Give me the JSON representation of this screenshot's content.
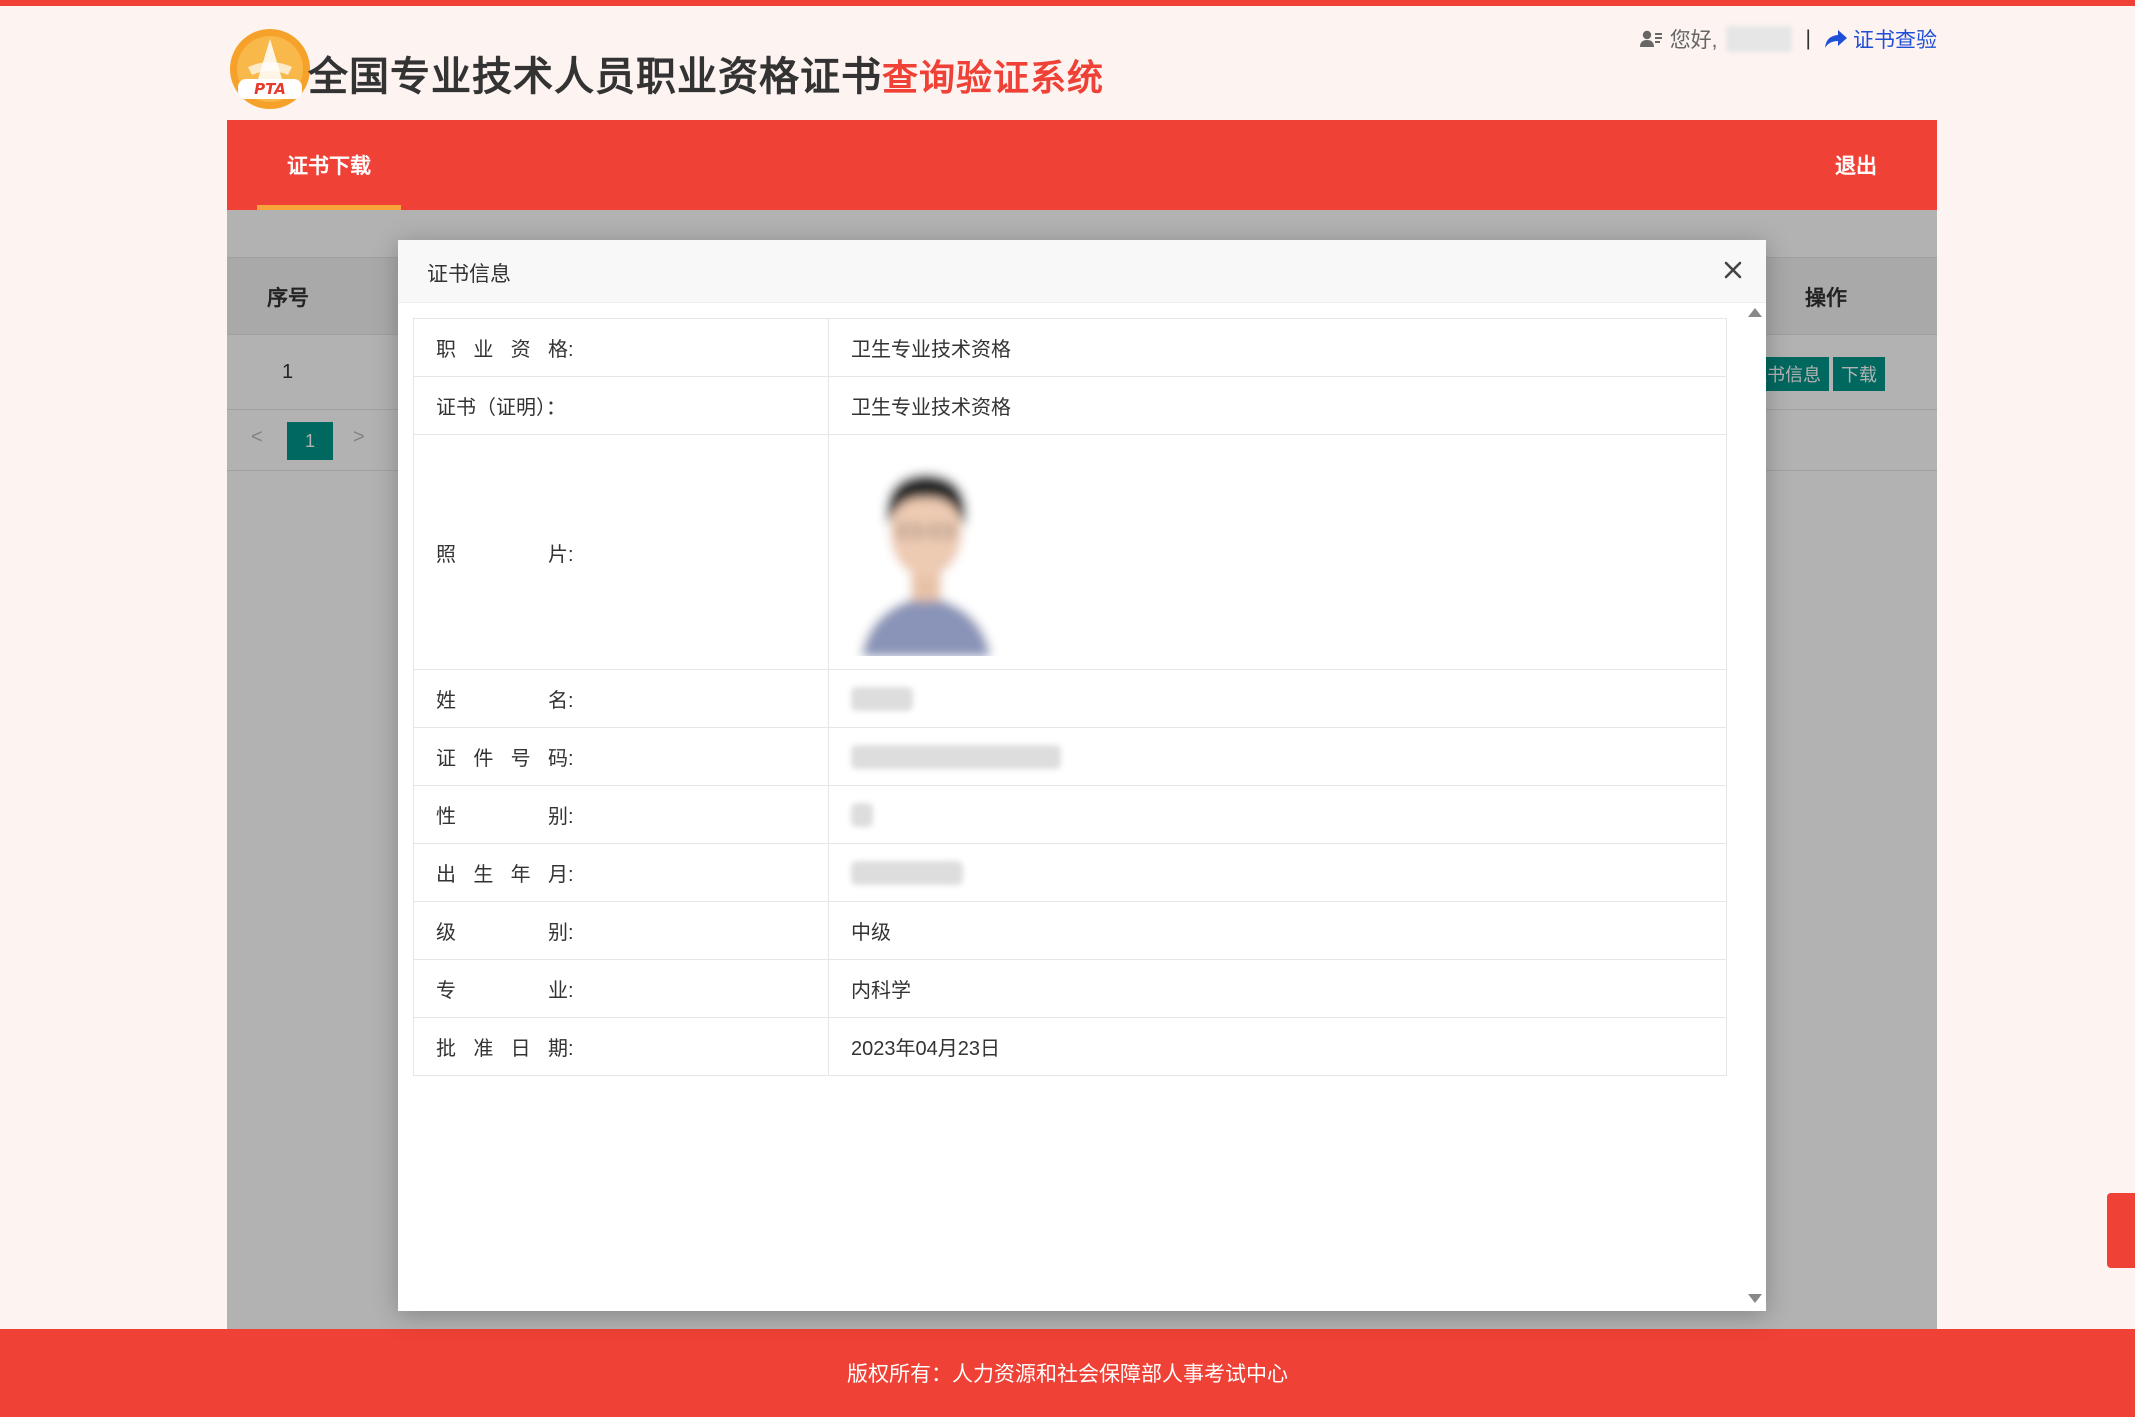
{
  "header": {
    "logo_text": "PTA",
    "title_main": "全国专业技术人员职业资格证书",
    "title_accent": "查询验证系统",
    "greeting": "您好,",
    "separator": "|",
    "verify_label": "证书查验"
  },
  "nav": {
    "active_tab": "证书下载",
    "logout": "退出"
  },
  "background_table": {
    "headers": {
      "index": "序号",
      "action": "操作"
    },
    "row": {
      "index": "1",
      "info_button": "证书信息",
      "download_button": "下载"
    },
    "pager": {
      "prev": "<",
      "current_page": "1",
      "next": ">"
    }
  },
  "modal": {
    "title": "证书信息",
    "rows": [
      {
        "label": "职业资格",
        "value": "卫生专业技术资格"
      },
      {
        "label": "证书（证明）",
        "value": "卫生专业技术资格"
      },
      {
        "label": "照片",
        "value": ""
      },
      {
        "label": "姓名",
        "value": ""
      },
      {
        "label": "证件号码",
        "value": ""
      },
      {
        "label": "性别",
        "value": ""
      },
      {
        "label": "出生年月",
        "value": ""
      },
      {
        "label": "级别",
        "value": "中级"
      },
      {
        "label": "专业",
        "value": "内科学"
      },
      {
        "label": "批准日期",
        "value": "2023年04月23日"
      }
    ],
    "colon": ":",
    "colon_full": "："
  },
  "footer": {
    "text": "版权所有：人力资源和社会保障部人事考试中心"
  }
}
